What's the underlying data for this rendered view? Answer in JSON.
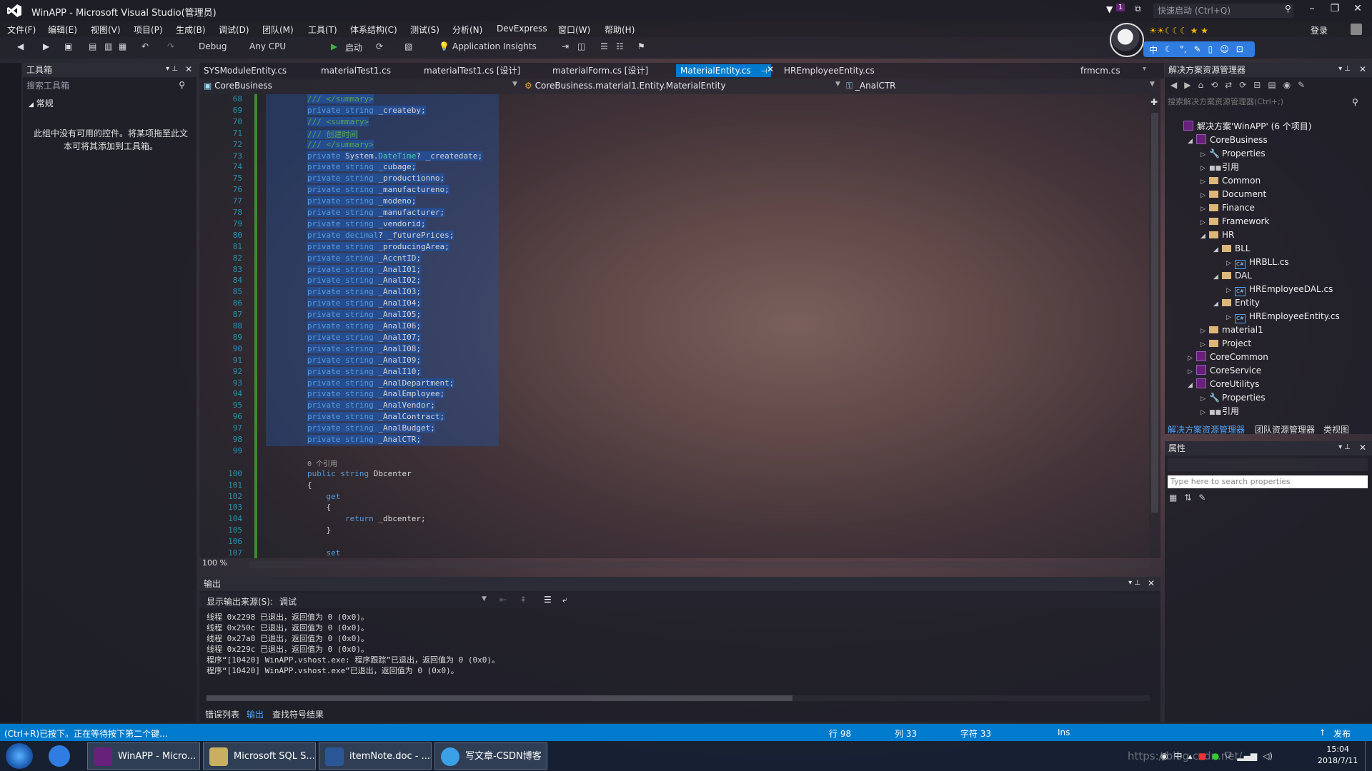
{
  "window": {
    "title": "WinAPP - Microsoft Visual Studio(管理员)",
    "quick_launch": "快速启动 (Ctrl+Q)",
    "notif_count": "1"
  },
  "menu": [
    "文件(F)",
    "编辑(E)",
    "视图(V)",
    "项目(P)",
    "生成(B)",
    "调试(D)",
    "团队(M)",
    "工具(T)",
    "体系结构(C)",
    "测试(S)",
    "分析(N)",
    "DevExpress",
    "窗口(W)",
    "帮助(H)"
  ],
  "login": "登录",
  "toolbar": {
    "config": "Debug",
    "platform": "Any CPU",
    "start": "启动",
    "insights": "Application Insights"
  },
  "ime": {
    "label": "中"
  },
  "toolbox": {
    "title": "工具箱",
    "search_placeholder": "搜索工具箱",
    "group": "常规",
    "empty_msg": "此组中没有可用的控件。将某项拖至此文本可将其添加到工具箱。"
  },
  "tabs": [
    {
      "label": "SYSModuleEntity.cs"
    },
    {
      "label": "materialTest1.cs"
    },
    {
      "label": "materialTest1.cs [设计]"
    },
    {
      "label": "materialForm.cs [设计]"
    },
    {
      "label": "MaterialEntity.cs"
    },
    {
      "label": "HREmployeeEntity.cs"
    },
    {
      "label": "frmcm.cs"
    }
  ],
  "navbar": {
    "project": "CoreBusiness",
    "type": "CoreBusiness.material1.Entity.MaterialEntity",
    "member": "_AnalCTR"
  },
  "editor": {
    "zoom": "100 %",
    "lines": [
      {
        "n": "68",
        "t": "/// </summary>",
        "c": "cm"
      },
      {
        "n": "69",
        "t": "private string _createby;",
        "c": ""
      },
      {
        "n": "70",
        "t": "/// <summary>",
        "c": "cm"
      },
      {
        "n": "71",
        "t": "/// 创建时间",
        "c": "cm"
      },
      {
        "n": "72",
        "t": "/// </summary>",
        "c": "cm"
      },
      {
        "n": "73",
        "t": "private System.DateTime? _createdate;",
        "c": ""
      },
      {
        "n": "74",
        "t": "private string _cubage;",
        "c": ""
      },
      {
        "n": "75",
        "t": "private string _productionno;",
        "c": ""
      },
      {
        "n": "76",
        "t": "private string _manufactureno;",
        "c": ""
      },
      {
        "n": "77",
        "t": "private string _modeno;",
        "c": ""
      },
      {
        "n": "78",
        "t": "private string _manufacturer;",
        "c": ""
      },
      {
        "n": "79",
        "t": "private string _vendorid;",
        "c": ""
      },
      {
        "n": "80",
        "t": "private decimal? _futurePrices;",
        "c": ""
      },
      {
        "n": "81",
        "t": "private string _producingArea;",
        "c": ""
      },
      {
        "n": "82",
        "t": "private string _AccntID;",
        "c": ""
      },
      {
        "n": "83",
        "t": "private string _AnalI01;",
        "c": ""
      },
      {
        "n": "84",
        "t": "private string _AnalI02;",
        "c": ""
      },
      {
        "n": "85",
        "t": "private string _AnalI03;",
        "c": ""
      },
      {
        "n": "86",
        "t": "private string _AnalI04;",
        "c": ""
      },
      {
        "n": "87",
        "t": "private string _AnalI05;",
        "c": ""
      },
      {
        "n": "88",
        "t": "private string _AnalI06;",
        "c": ""
      },
      {
        "n": "89",
        "t": "private string _AnalI07;",
        "c": ""
      },
      {
        "n": "90",
        "t": "private string _AnalI08;",
        "c": ""
      },
      {
        "n": "91",
        "t": "private string _AnalI09;",
        "c": ""
      },
      {
        "n": "92",
        "t": "private string _AnalI10;",
        "c": ""
      },
      {
        "n": "93",
        "t": "private string _AnalDepartment;",
        "c": ""
      },
      {
        "n": "94",
        "t": "private string _AnalEmployee;",
        "c": ""
      },
      {
        "n": "95",
        "t": "private string _AnalVendor;",
        "c": ""
      },
      {
        "n": "96",
        "t": "private string _AnalContract;",
        "c": ""
      },
      {
        "n": "97",
        "t": "private string _AnalBudget;",
        "c": ""
      },
      {
        "n": "98",
        "t": "private string _AnalCTR;",
        "c": ""
      },
      {
        "n": "99",
        "t": "",
        "c": ""
      },
      {
        "n": "",
        "t": "0 个引用",
        "c": "ref"
      },
      {
        "n": "100",
        "t": "public string Dbcenter",
        "c": ""
      },
      {
        "n": "101",
        "t": "{",
        "c": ""
      },
      {
        "n": "102",
        "t": "    get",
        "c": ""
      },
      {
        "n": "103",
        "t": "    {",
        "c": ""
      },
      {
        "n": "104",
        "t": "        return _dbcenter;",
        "c": ""
      },
      {
        "n": "105",
        "t": "    }",
        "c": ""
      },
      {
        "n": "106",
        "t": "",
        "c": ""
      },
      {
        "n": "107",
        "t": "    set",
        "c": ""
      }
    ]
  },
  "output": {
    "title": "输出",
    "source_label": "显示输出来源(S):",
    "source_value": "调试",
    "lines": [
      "线程 0x2298 已退出，返回值为 0 (0x0)。",
      "线程 0x250c 已退出，返回值为 0 (0x0)。",
      "线程 0x27a8 已退出，返回值为 0 (0x0)。",
      "线程 0x229c 已退出，返回值为 0 (0x0)。",
      "程序“[10420] WinAPP.vshost.exe: 程序跟踪”已退出，返回值为 0 (0x0)。",
      "程序“[10420] WinAPP.vshost.exe”已退出，返回值为 0 (0x0)。"
    ],
    "tabs": [
      "错误列表",
      "输出",
      "查找符号结果"
    ]
  },
  "solution": {
    "title": "解决方案资源管理器",
    "search_placeholder": "搜索解决方案资源管理器(Ctrl+;)",
    "items": [
      {
        "label": "解决方案'WinAPP' (6 个项目)",
        "kind": "sln",
        "indent": 0,
        "exp": ""
      },
      {
        "label": "CoreBusiness",
        "kind": "proj",
        "indent": 1,
        "exp": "open"
      },
      {
        "label": "Properties",
        "kind": "wrench",
        "indent": 2,
        "exp": "closed"
      },
      {
        "label": "引用",
        "kind": "ref",
        "indent": 2,
        "exp": "closed"
      },
      {
        "label": "Common",
        "kind": "folder",
        "indent": 2,
        "exp": "closed"
      },
      {
        "label": "Document",
        "kind": "folder",
        "indent": 2,
        "exp": "closed"
      },
      {
        "label": "Finance",
        "kind": "folder",
        "indent": 2,
        "exp": "closed"
      },
      {
        "label": "Framework",
        "kind": "folder",
        "indent": 2,
        "exp": "closed"
      },
      {
        "label": "HR",
        "kind": "folder",
        "indent": 2,
        "exp": "open"
      },
      {
        "label": "BLL",
        "kind": "folder",
        "indent": 3,
        "exp": "open"
      },
      {
        "label": "HRBLL.cs",
        "kind": "cs",
        "indent": 4,
        "exp": "closed"
      },
      {
        "label": "DAL",
        "kind": "folder",
        "indent": 3,
        "exp": "open"
      },
      {
        "label": "HREmployeeDAL.cs",
        "kind": "cs",
        "indent": 4,
        "exp": "closed"
      },
      {
        "label": "Entity",
        "kind": "folder",
        "indent": 3,
        "exp": "open"
      },
      {
        "label": "HREmployeeEntity.cs",
        "kind": "cs",
        "indent": 4,
        "exp": "closed"
      },
      {
        "label": "material1",
        "kind": "folder",
        "indent": 2,
        "exp": "closed"
      },
      {
        "label": "Project",
        "kind": "folder",
        "indent": 2,
        "exp": "closed"
      },
      {
        "label": "CoreCommon",
        "kind": "proj",
        "indent": 1,
        "exp": "closed"
      },
      {
        "label": "CoreService",
        "kind": "proj",
        "indent": 1,
        "exp": "closed"
      },
      {
        "label": "CoreUtilitys",
        "kind": "proj",
        "indent": 1,
        "exp": "open"
      },
      {
        "label": "Properties",
        "kind": "wrench",
        "indent": 2,
        "exp": "closed"
      },
      {
        "label": "引用",
        "kind": "ref",
        "indent": 2,
        "exp": "closed"
      }
    ],
    "tabs": [
      "解决方案资源管理器",
      "团队资源管理器",
      "类视图"
    ]
  },
  "properties": {
    "title": "属性",
    "search_placeholder": "Type here to search properties"
  },
  "status": {
    "message": "(Ctrl+R)已按下。正在等待按下第二个键...",
    "line": "行 98",
    "col": "列 33",
    "char": "字符 33",
    "mode": "Ins",
    "publish": "发布"
  },
  "taskbar": {
    "tasks": [
      "WinAPP - Micro...",
      "Microsoft SQL S...",
      "itemNote.doc - ...",
      "写文章-CSDN博客"
    ],
    "time": "15:04",
    "date": "2018/7/11",
    "watermark": "https://blog.csdn.net/..."
  },
  "colors": {
    "accent": "#007acc",
    "selection": "#264f96",
    "keyword": "#569cd6",
    "type": "#4ec9b0",
    "comment": "#57a64a",
    "linenum": "#2b91af"
  }
}
